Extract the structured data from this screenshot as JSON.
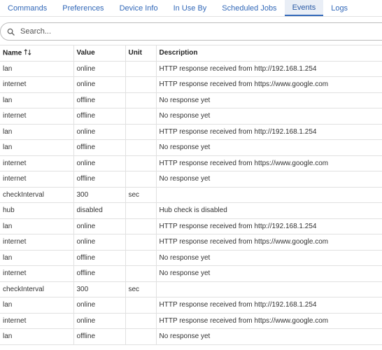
{
  "tabs": [
    {
      "label": "Commands",
      "active": false
    },
    {
      "label": "Preferences",
      "active": false
    },
    {
      "label": "Device Info",
      "active": false
    },
    {
      "label": "In Use By",
      "active": false
    },
    {
      "label": "Scheduled Jobs",
      "active": false
    },
    {
      "label": "Events",
      "active": true
    },
    {
      "label": "Logs",
      "active": false
    }
  ],
  "search": {
    "placeholder": "Search...",
    "value": ""
  },
  "table": {
    "columns": [
      "Name",
      "Value",
      "Unit",
      "Description"
    ],
    "sort_icon": "sort-updown-icon",
    "rows": [
      {
        "name": "lan",
        "value": "online",
        "unit": "",
        "description": "HTTP response received from http://192.168.1.254"
      },
      {
        "name": "internet",
        "value": "online",
        "unit": "",
        "description": "HTTP response received from https://www.google.com"
      },
      {
        "name": "lan",
        "value": "offline",
        "unit": "",
        "description": "No response yet"
      },
      {
        "name": "internet",
        "value": "offline",
        "unit": "",
        "description": "No response yet"
      },
      {
        "name": "lan",
        "value": "online",
        "unit": "",
        "description": "HTTP response received from http://192.168.1.254"
      },
      {
        "name": "lan",
        "value": "offline",
        "unit": "",
        "description": "No response yet"
      },
      {
        "name": "internet",
        "value": "online",
        "unit": "",
        "description": "HTTP response received from https://www.google.com"
      },
      {
        "name": "internet",
        "value": "offline",
        "unit": "",
        "description": "No response yet"
      },
      {
        "name": "checkInterval",
        "value": "300",
        "unit": "sec",
        "description": ""
      },
      {
        "name": "hub",
        "value": "disabled",
        "unit": "",
        "description": "Hub check is disabled"
      },
      {
        "name": "lan",
        "value": "online",
        "unit": "",
        "description": "HTTP response received from http://192.168.1.254"
      },
      {
        "name": "internet",
        "value": "online",
        "unit": "",
        "description": "HTTP response received from https://www.google.com"
      },
      {
        "name": "lan",
        "value": "offline",
        "unit": "",
        "description": "No response yet"
      },
      {
        "name": "internet",
        "value": "offline",
        "unit": "",
        "description": "No response yet"
      },
      {
        "name": "checkInterval",
        "value": "300",
        "unit": "sec",
        "description": ""
      },
      {
        "name": "lan",
        "value": "online",
        "unit": "",
        "description": "HTTP response received from http://192.168.1.254"
      },
      {
        "name": "internet",
        "value": "online",
        "unit": "",
        "description": "HTTP response received from https://www.google.com"
      },
      {
        "name": "lan",
        "value": "offline",
        "unit": "",
        "description": "No response yet"
      }
    ]
  },
  "colors": {
    "accent": "#3268b8",
    "active_tab_bg": "#e9eef6"
  }
}
